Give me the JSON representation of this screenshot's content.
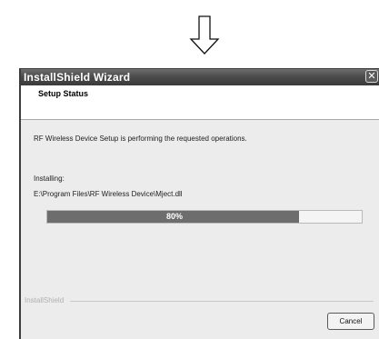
{
  "window": {
    "title": "InstallShield Wizard",
    "close_glyph": "✕",
    "close_icon": "close-icon"
  },
  "header": {
    "title": "Setup Status"
  },
  "content": {
    "status_message": "RF Wireless Device Setup is performing the requested operations.",
    "installing_label": "Installing:",
    "file_path": "E:\\Program Files\\RF Wireless Device\\Mject.dll"
  },
  "progress": {
    "percent": 80,
    "label": "80%"
  },
  "footer": {
    "brand": "InstallShield",
    "cancel_label": "Cancel"
  },
  "decoration": {
    "arrow_icon": "down-arrow-icon"
  }
}
